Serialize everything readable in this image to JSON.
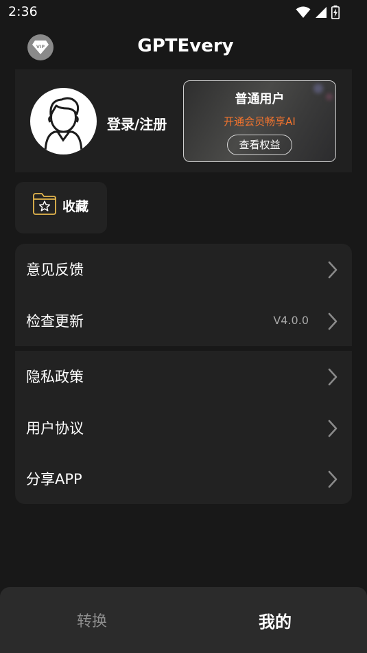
{
  "status_bar": {
    "time": "2:36"
  },
  "app_bar": {
    "title": "GPTEvery",
    "vip_badge_text": "VIP"
  },
  "profile": {
    "login_label": "登录/注册",
    "membership": {
      "title": "普通用户",
      "subtitle": "开通会员畅享AI",
      "button_label": "查看权益"
    }
  },
  "favorites": {
    "label": "收藏"
  },
  "menu": {
    "group1": [
      {
        "label": "意见反馈",
        "value": ""
      },
      {
        "label": "检查更新",
        "value": "V4.0.0"
      }
    ],
    "group2": [
      {
        "label": "隐私政策",
        "value": ""
      },
      {
        "label": "用户协议",
        "value": ""
      },
      {
        "label": "分享APP",
        "value": ""
      }
    ]
  },
  "bottom_nav": {
    "tabs": [
      {
        "label": "转换",
        "active": false
      },
      {
        "label": "我的",
        "active": true
      }
    ]
  },
  "colors": {
    "background": "#181818",
    "card": "#222222",
    "accent_orange": "#f0732e",
    "muted_text": "#a8a8a8",
    "nav_bar": "#2b2b2b"
  },
  "icons": [
    "wifi-icon",
    "signal-icon",
    "battery-icon",
    "vip-icon",
    "avatar-icon",
    "favorites-folder-icon",
    "chevron-right-icon"
  ]
}
